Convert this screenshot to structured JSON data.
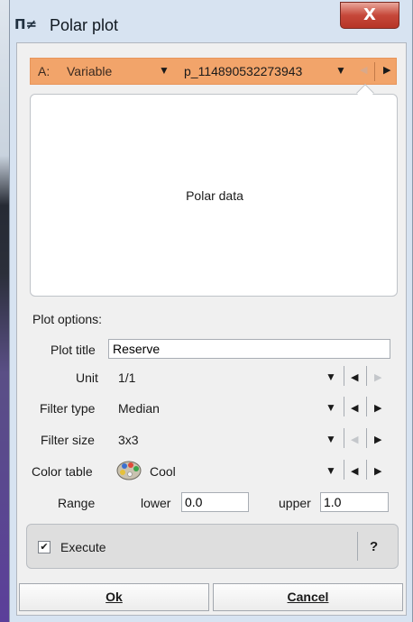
{
  "window": {
    "title": "Polar plot",
    "close_label": "X",
    "app_icon_glyph": "Π≠"
  },
  "selector": {
    "slot_label": "A:",
    "variable_label": "Variable",
    "dataset_label": "p_114890532273943",
    "prev_enabled": false,
    "next_enabled": true
  },
  "polar_panel": {
    "label": "Polar data"
  },
  "plot_options": {
    "header": "Plot options:",
    "plot_title": {
      "label": "Plot title",
      "value": "Reserve"
    },
    "unit": {
      "label": "Unit",
      "value": "1/1"
    },
    "filter_type": {
      "label": "Filter type",
      "value": "Median"
    },
    "filter_size": {
      "label": "Filter size",
      "value": "3x3"
    },
    "color_table": {
      "label": "Color table",
      "value": "Cool",
      "icon": "palette-icon"
    },
    "range": {
      "label": "Range",
      "lower_label": "lower",
      "lower_value": "0.0",
      "upper_label": "upper",
      "upper_value": "1.0"
    }
  },
  "execute": {
    "label": "Execute",
    "checked": true,
    "help_label": "?"
  },
  "buttons": {
    "ok": "Ok",
    "cancel": "Cancel"
  },
  "colors": {
    "selector_bar": "#f2a46a",
    "close_button": "#c6483a",
    "window_frame": "#d7e3f1"
  }
}
